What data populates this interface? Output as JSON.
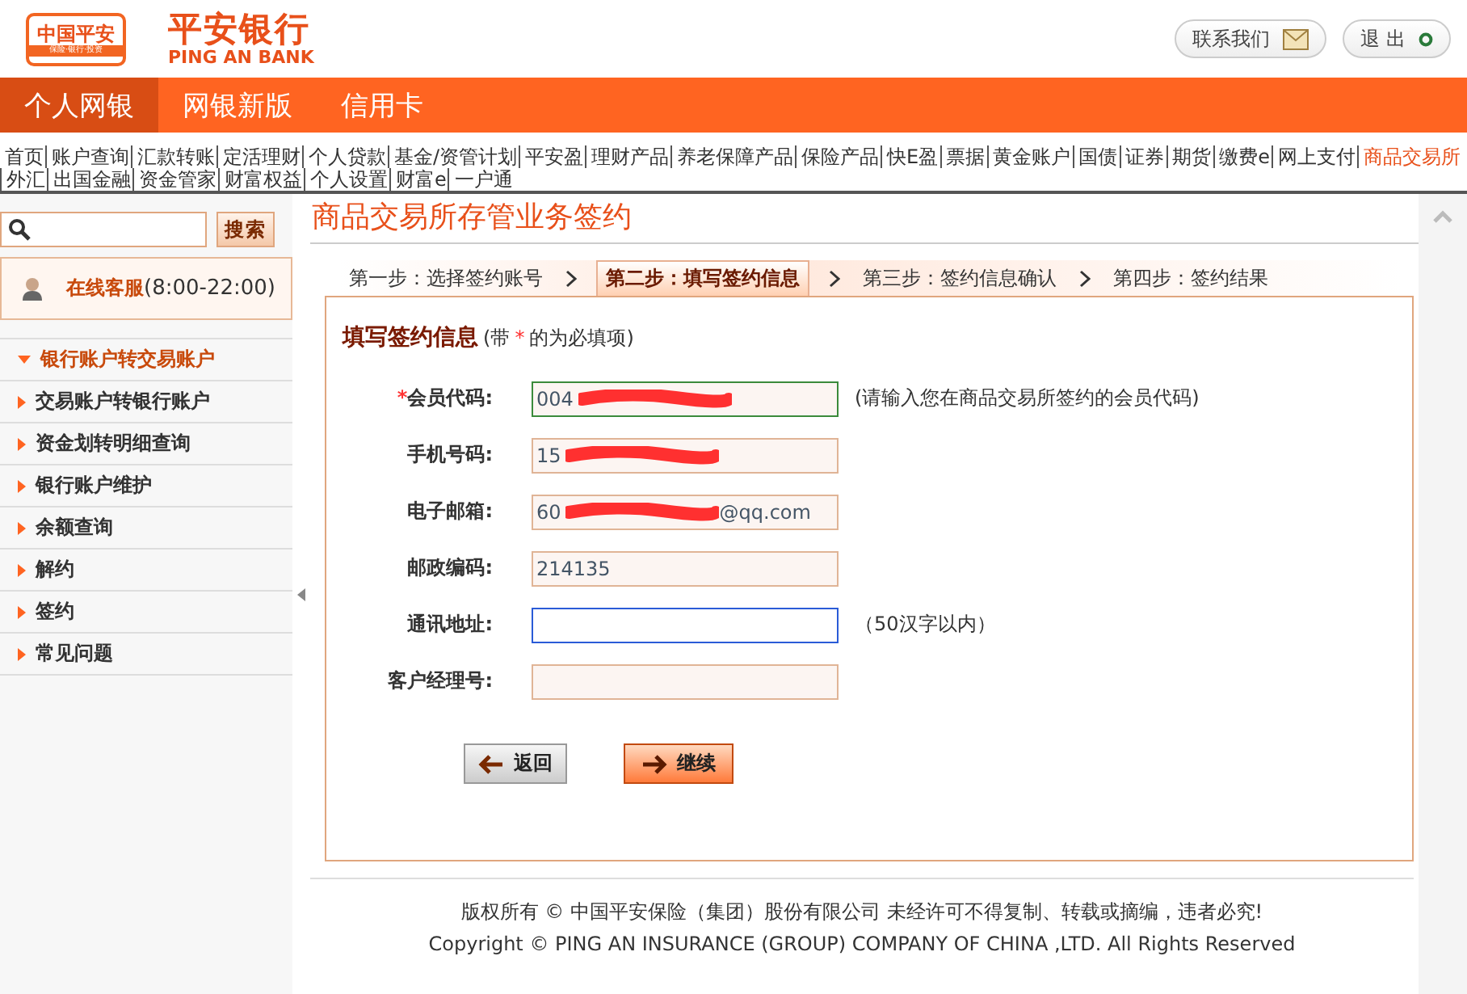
{
  "header": {
    "logo_badge": "中国平安",
    "logo_badge_sub": "保险·银行·投资",
    "brand": "平安银行",
    "brand_en": "PING AN BANK",
    "links": [
      {
        "label": "联系我们",
        "kind": "mail"
      },
      {
        "label": "退 出",
        "kind": "exit"
      }
    ]
  },
  "tabs": [
    {
      "label": "个人网银",
      "selected": true
    },
    {
      "label": "网银新版",
      "selected": false
    },
    {
      "label": "信用卡",
      "selected": false
    }
  ],
  "nav": [
    {
      "label": "首页",
      "selected": false
    },
    {
      "label": "账户查询",
      "selected": false
    },
    {
      "label": "汇款转账",
      "selected": false
    },
    {
      "label": "定活理财",
      "selected": false
    },
    {
      "label": "个人贷款",
      "selected": false
    },
    {
      "label": "基金/资管计划",
      "selected": false
    },
    {
      "label": "平安盈",
      "selected": false
    },
    {
      "label": "理财产品",
      "selected": false
    },
    {
      "label": "养老保障产品",
      "selected": false
    },
    {
      "label": "保险产品",
      "selected": false
    },
    {
      "label": "快E盈",
      "selected": false
    },
    {
      "label": "票据",
      "selected": false
    },
    {
      "label": "黄金账户",
      "selected": false
    },
    {
      "label": "国债",
      "selected": false
    },
    {
      "label": "证券",
      "selected": false
    },
    {
      "label": "期货",
      "selected": false
    },
    {
      "label": "缴费e",
      "selected": false
    },
    {
      "label": "网上支付",
      "selected": false
    },
    {
      "label": "商品交易所",
      "selected": true
    },
    {
      "label": "外汇",
      "selected": false
    },
    {
      "label": "出国金融",
      "selected": false
    },
    {
      "label": "资金管家",
      "selected": false
    },
    {
      "label": "财富权益",
      "selected": false
    },
    {
      "label": "个人设置",
      "selected": false
    },
    {
      "label": "财富e",
      "selected": false
    },
    {
      "label": "一户通",
      "selected": false
    }
  ],
  "sidebar": {
    "search_button": "搜索",
    "service_label": "在线客服",
    "service_hours": "(8:00-22:00)",
    "items": [
      {
        "label": "银行账户转交易账户",
        "selected": true
      },
      {
        "label": "交易账户转银行账户",
        "selected": false
      },
      {
        "label": "资金划转明细查询",
        "selected": false
      },
      {
        "label": "银行账户维护",
        "selected": false
      },
      {
        "label": "余额查询",
        "selected": false
      },
      {
        "label": "解约",
        "selected": false
      },
      {
        "label": "签约",
        "selected": false
      },
      {
        "label": "常见问题",
        "selected": false
      }
    ]
  },
  "page_title": "商品交易所存管业务签约",
  "steps": [
    {
      "label": "第一步：选择签约账号",
      "selected": false
    },
    {
      "label": "第二步：填写签约信息",
      "selected": true
    },
    {
      "label": "第三步：签约信息确认",
      "selected": false
    },
    {
      "label": "第四步：签约结果",
      "selected": false
    }
  ],
  "form": {
    "heading": "填写签约信息",
    "note_start": "(带",
    "note_mark": "*",
    "note_end": "的为必填项)",
    "fields": [
      {
        "label": "会员代码:",
        "required": true,
        "valid": true,
        "focused": false,
        "value": "004",
        "redacted": true,
        "hint": "(请输入您在商品交易所签约的会员代码)"
      },
      {
        "label": "手机号码:",
        "required": false,
        "valid": false,
        "focused": false,
        "value": "15",
        "redacted": true
      },
      {
        "label": "电子邮箱:",
        "required": false,
        "valid": false,
        "focused": false,
        "value": "60",
        "redacted": true,
        "value_end": "@qq.com"
      },
      {
        "label": "邮政编码:",
        "required": false,
        "valid": false,
        "focused": false,
        "value": "214135",
        "redacted": false
      },
      {
        "label": "通讯地址:",
        "required": false,
        "valid": false,
        "focused": true,
        "redacted": false,
        "hint": "（50汉字以内）"
      },
      {
        "label": "客户经理号:",
        "required": false,
        "valid": false,
        "focused": false,
        "redacted": false
      }
    ],
    "buttons": [
      {
        "label": "返回",
        "kind": "back"
      },
      {
        "label": "继续",
        "kind": "next"
      }
    ]
  },
  "footer": {
    "line1": "版权所有 © 中国平安保险（集团）股份有限公司 未经许可不得复制、转载或摘编，违者必究!",
    "line2": "Copyright © PING AN INSURANCE (GROUP) COMPANY OF CHINA ,LTD. All Rights Reserved"
  }
}
